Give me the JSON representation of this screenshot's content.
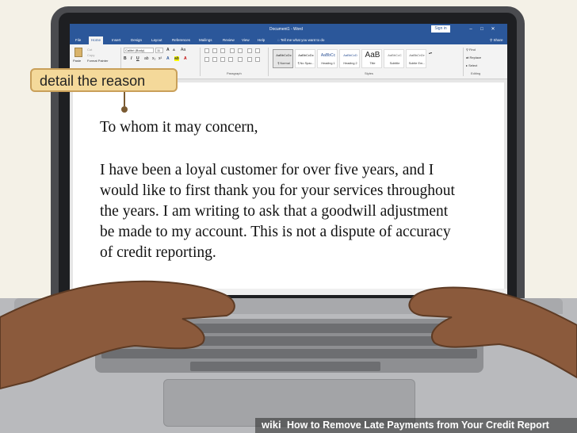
{
  "word": {
    "doc_title": "Document1 - Word",
    "sign_in": "Sign in",
    "tabs": [
      "File",
      "Home",
      "Insert",
      "Design",
      "Layout",
      "References",
      "Mailings",
      "Review",
      "View",
      "Help"
    ],
    "tell_me": "Tell me what you want to do",
    "share": "Share",
    "ribbon": {
      "paste": "Paste",
      "cut": "Cut",
      "copy": "Copy",
      "format_painter": "Format Painter",
      "font_name": "Calibri (Body)",
      "font_size": "11",
      "paragraph_label": "Paragraph",
      "styles_label": "Styles",
      "editing_label": "Editing",
      "find": "Find",
      "replace": "Replace",
      "select": "Select",
      "styles": [
        {
          "sample": "AaBbCcDc",
          "name": "¶ Normal"
        },
        {
          "sample": "AaBbCcDc",
          "name": "¶ No Spac..."
        },
        {
          "sample": "AaBbCc",
          "name": "Heading 1"
        },
        {
          "sample": "AaBbCcD",
          "name": "Heading 2"
        },
        {
          "sample": "AaB",
          "name": "Title"
        },
        {
          "sample": "AaBbCcC",
          "name": "Subtitle"
        },
        {
          "sample": "AaBbCcDc",
          "name": "Subtle Em..."
        }
      ]
    },
    "document": {
      "lines": [
        "To whom it may concern,",
        "",
        "I have been a loyal customer for over five years, and I",
        "would like to first thank you for your services throughout",
        "the years. I am writing to ask that a goodwill adjustment",
        "be made to my account. This is not a dispute of accuracy",
        "of credit reporting."
      ]
    }
  },
  "callout": {
    "text": "detail the reason"
  },
  "caption": {
    "logo": "wiki",
    "text": "How to Remove Late Payments from Your Credit Report"
  }
}
